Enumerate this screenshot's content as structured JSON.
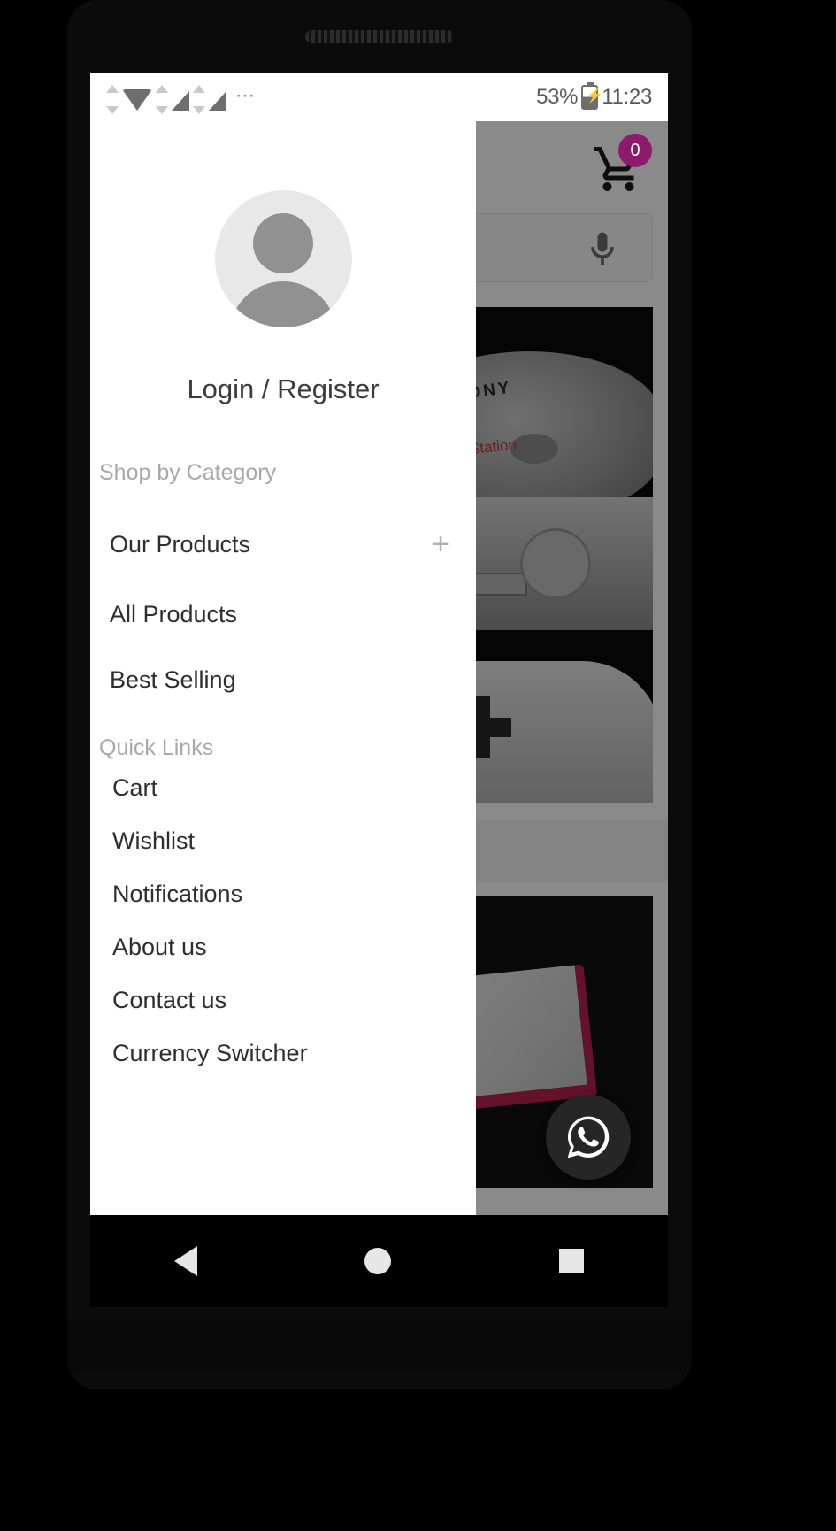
{
  "status_bar": {
    "wifi_icon": "wifi-icon",
    "signal_icon": "cellular-signal-icon",
    "signal_no_sim_icon": "cellular-no-sim-icon",
    "more_icon": "more-dots-icon",
    "battery_percent": "53%",
    "battery_icon": "battery-charging-icon",
    "time": "11:23"
  },
  "background_app": {
    "cart_icon": "shopping-cart-icon",
    "cart_badge_count": "0",
    "mic_icon": "microphone-icon",
    "banner_brand": "SONY",
    "banner_sub_logo": "PlayStation",
    "whatsapp_fab_icon": "whatsapp-icon"
  },
  "drawer": {
    "avatar_icon": "user-avatar-placeholder-icon",
    "login_label": "Login / Register",
    "category_section_label": "Shop by Category",
    "category_items": [
      {
        "label": "Our Products",
        "expand_icon": "plus-icon",
        "expand_symbol": "+"
      },
      {
        "label": "All Products"
      },
      {
        "label": "Best Selling"
      }
    ],
    "quick_links_label": "Quick Links",
    "quick_links": [
      {
        "label": "Cart"
      },
      {
        "label": "Wishlist"
      },
      {
        "label": "Notifications"
      },
      {
        "label": "About us"
      },
      {
        "label": "Contact us"
      },
      {
        "label": "Currency Switcher"
      }
    ]
  },
  "nav_bar": {
    "back_icon": "back-triangle-icon",
    "home_icon": "home-circle-icon",
    "recents_icon": "recents-square-icon"
  },
  "colors": {
    "badge": "#8e1a6b",
    "drawer_bg": "#ffffff",
    "text_primary": "#2e2e2e",
    "text_muted": "#a8a8a8"
  }
}
